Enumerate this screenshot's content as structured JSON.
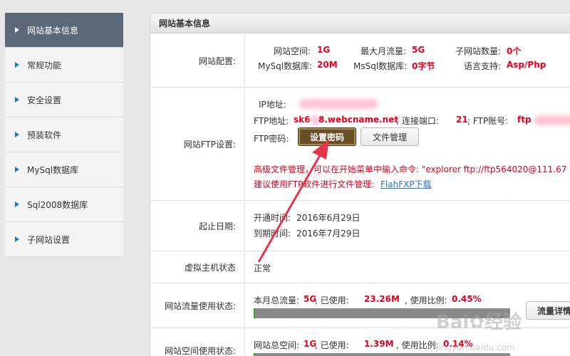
{
  "sidebar": {
    "items": [
      {
        "label": "网站基本信息",
        "active": true
      },
      {
        "label": "常规功能"
      },
      {
        "label": "安全设置"
      },
      {
        "label": "预装软件"
      },
      {
        "label": "MySql数据库"
      },
      {
        "label": "Sql2008数据库"
      },
      {
        "label": "子网站设置"
      }
    ]
  },
  "panel": {
    "title": "网站基本信息",
    "config": {
      "label": "网站配置:",
      "space_label": "网站空间:",
      "space_value": "1G",
      "traffic_label": "最大月流量:",
      "traffic_value": "5G",
      "subsites_label": "子网站数量:",
      "subsites_value": "0个",
      "mysql_label": "MySql数据库:",
      "mysql_value": "20M",
      "mssql_label": "MsSql数据库:",
      "mssql_value": "0字节",
      "lang_label": "语言支持:",
      "lang_value": "Asp/Php"
    },
    "ftp": {
      "label": "网站FTP设置:",
      "ip_label": "IP地址:",
      "addr_label": "FTP地址:",
      "addr_value_a": "sk6",
      "addr_value_b": "8.webcname.net",
      "port_label": "; 连接端口:",
      "port_value": "21",
      "account_label": "; FTP账号:",
      "account_value": "ftp",
      "pwd_label": "FTP密码:",
      "set_pwd_button": "设置密码",
      "file_mgr_button": "文件管理",
      "adv_note": "高级文件管理，可以在开始菜单中输入命令: \"explorer ftp://ftp564020@111.67",
      "suggest_note": "建议使用FTP软件进行文件管理:",
      "fxp_link": "FlahFXP下载"
    },
    "dates": {
      "label": "起止日期:",
      "open_label": "开通时间:",
      "open_value": "2016年6月29日",
      "expire_label": "到期时间:",
      "expire_value": "2016年7月29日"
    },
    "status": {
      "label": "虚拟主机状态",
      "value": "正常"
    },
    "traffic_usage": {
      "label": "网站流量使用状态:",
      "total_label": "本月总流量:",
      "total_value": "5G",
      "used_label": ", 已使用:",
      "used_value": "23.26M",
      "ratio_label": ", 使用比例:",
      "ratio_value": "0.45%",
      "fill_percent": 0.45,
      "detail_button": "流量详情"
    },
    "space_usage": {
      "label": "网站空间使用状态:",
      "total_label": "网站总空间:",
      "total_value": "1G",
      "used_label": ", 已使用:",
      "used_value": "1.39M",
      "ratio_label": ", 使用比例:",
      "ratio_value": "0.14%",
      "fill_percent": 0.14
    }
  },
  "watermark": {
    "text": "Bai",
    "text2": "经验",
    "sub": "jingyan.baidu.com"
  },
  "colors": {
    "accent_red": "#e4001c",
    "sidebar_active": "#5a6877",
    "bar_green": "#2ea22e",
    "button_dark": "#6b4e24"
  }
}
